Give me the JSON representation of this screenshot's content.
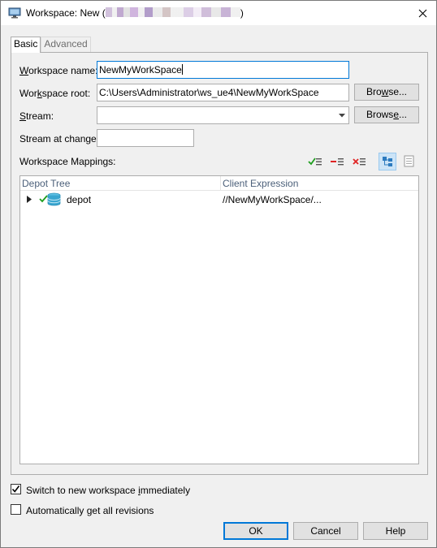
{
  "window": {
    "title_prefix": "Workspace: New (",
    "title_suffix": ")",
    "close_glyph": "✕",
    "icon": "monitor-icon"
  },
  "tabs": [
    {
      "label": "Basic",
      "active": true
    },
    {
      "label": "Advanced",
      "active": false
    }
  ],
  "form": {
    "workspace_name": {
      "label_u": "W",
      "label_rest": "orkspace name:",
      "value": "NewMyWorkSpace"
    },
    "workspace_root": {
      "label_pre": "Wor",
      "label_u": "k",
      "label_rest": "space root:",
      "value": "C:\\Users\\Administrator\\ws_ue4\\NewMyWorkSpace",
      "browse_pre": "Bro",
      "browse_u": "w",
      "browse_rest": "se..."
    },
    "stream": {
      "label_u": "S",
      "label_rest": "tream:",
      "value": "",
      "browse_pre": "Brows",
      "browse_u": "e",
      "browse_rest": "..."
    },
    "stream_at_change": {
      "label": "Stream at change:",
      "value": ""
    },
    "mappings_label": "Workspace Mappings:"
  },
  "toolbar": {
    "include_icon": "include-mapping-icon",
    "exclude_icon": "exclude-mapping-icon",
    "remove_icon": "remove-mapping-icon",
    "tree_view_icon": "tree-view-icon",
    "text_view_icon": "text-view-icon"
  },
  "tree": {
    "columns": [
      "Depot Tree",
      "Client Expression"
    ],
    "rows": [
      {
        "name": "depot",
        "expression": "//NewMyWorkSpace/...",
        "expanded": false,
        "mapped": true
      }
    ]
  },
  "options": {
    "switch_immediately": {
      "pre": "Switch to new workspace ",
      "u": "i",
      "rest": "mmediately",
      "checked": true
    },
    "get_all_revisions": {
      "pre": "Automatically ",
      "u": "g",
      "rest": "et all revisions",
      "checked": false
    }
  },
  "buttons": {
    "ok": "OK",
    "cancel": "Cancel",
    "help": "Help"
  },
  "colors": {
    "accent": "#0078d7",
    "check_green": "#1e9e1e",
    "remove_red": "#e02424",
    "depot_blue": "#3aa6d0"
  }
}
